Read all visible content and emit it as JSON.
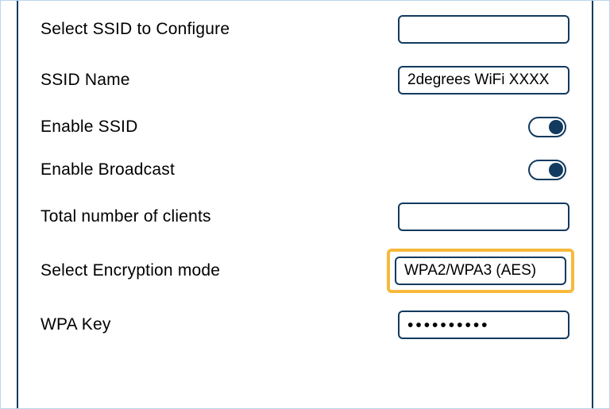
{
  "form": {
    "select_ssid_label": "Select SSID to Configure",
    "select_ssid_value": "",
    "ssid_name_label": "SSID Name",
    "ssid_name_value": "2degrees WiFi XXXX",
    "enable_ssid_label": "Enable SSID",
    "enable_ssid_on": true,
    "enable_broadcast_label": "Enable Broadcast",
    "enable_broadcast_on": true,
    "total_clients_label": "Total number of clients",
    "total_clients_value": "",
    "encryption_label": "Select Encryption mode",
    "encryption_value": "WPA2/WPA3 (AES)",
    "wpa_key_label": "WPA Key",
    "wpa_key_masked": "••••••••••"
  }
}
